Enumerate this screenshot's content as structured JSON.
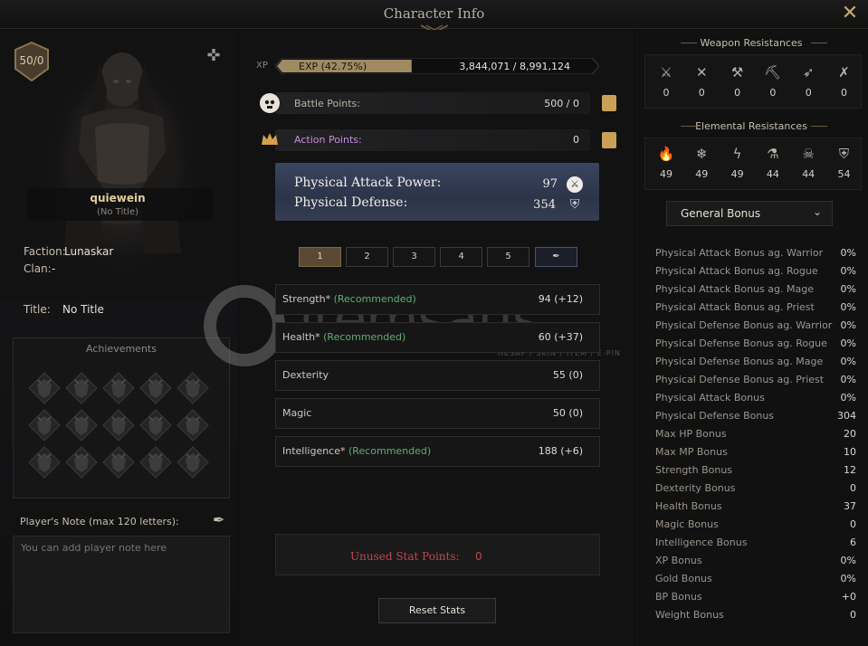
{
  "window": {
    "title": "Character Info",
    "close_icon": "close-x-icon"
  },
  "character": {
    "level": "50/0",
    "name": "quiewein",
    "subtitle": "(No Title)",
    "faction_label": "Faction:",
    "faction": "Lunaskar",
    "clan_label": "Clan:",
    "clan": "-",
    "title_label": "Title:",
    "title": "No Title"
  },
  "achievements": {
    "title": "Achievements",
    "count": 15
  },
  "note": {
    "label": "Player's Note (max 120 letters):",
    "placeholder": "You can add player note here"
  },
  "xp": {
    "label": "XP",
    "bar_text": "EXP (42.75%)",
    "values": "3,844,071 / 8,991,124",
    "fill_fraction": 0.4275
  },
  "battle_points": {
    "label": "Battle Points:",
    "value": "500 / 0"
  },
  "action_points": {
    "label": "Action Points:",
    "value": "0"
  },
  "attack": {
    "phys_attack_label": "Physical Attack Power:",
    "phys_attack_value": "97",
    "phys_defense_label": "Physical Defense:",
    "phys_defense_value": "354"
  },
  "tabs": [
    "1",
    "2",
    "3",
    "4",
    "5"
  ],
  "stats": [
    {
      "name": "Strength*",
      "rec": "(Recommended)",
      "value": "94 (+12)"
    },
    {
      "name": "Health*",
      "rec": "(Recommended)",
      "value": "60 (+37)"
    },
    {
      "name": "Dexterity",
      "rec": "",
      "value": "55 (0)"
    },
    {
      "name": "Magic",
      "rec": "",
      "value": "50 (0)"
    },
    {
      "name": "Intelligence*",
      "rec": "(Recommended)",
      "value": "188 (+6)"
    }
  ],
  "unused": {
    "label": "Unused Stat Points:",
    "value": "0"
  },
  "reset_label": "Reset Stats",
  "weapon_res": {
    "title": "Weapon Resistances",
    "icons": [
      "crossed-swords-icon",
      "axes-icon",
      "hammer-icon",
      "pickaxe-icon",
      "arrows-icon",
      "crossed-spears-icon"
    ],
    "values": [
      "0",
      "0",
      "0",
      "0",
      "0",
      "0"
    ]
  },
  "elemental_res": {
    "title": "Elemental Resistances",
    "icons": [
      "fire-icon",
      "ice-icon",
      "lightning-icon",
      "poison-icon",
      "curse-icon",
      "shield-icon"
    ],
    "values": [
      "49",
      "49",
      "49",
      "44",
      "44",
      "54"
    ]
  },
  "bonus_select": "General Bonus",
  "bonuses": [
    {
      "name": "Physical Attack Bonus ag. Warrior",
      "value": "0%"
    },
    {
      "name": "Physical Attack Bonus ag. Rogue",
      "value": "0%"
    },
    {
      "name": "Physical Attack Bonus ag. Mage",
      "value": "0%"
    },
    {
      "name": "Physical Attack Bonus ag. Priest",
      "value": "0%"
    },
    {
      "name": "Physical Defense Bonus ag. Warrior",
      "value": "0%"
    },
    {
      "name": "Physical Defense Bonus ag. Rogue",
      "value": "0%"
    },
    {
      "name": "Physical Defense Bonus ag. Mage",
      "value": "0%"
    },
    {
      "name": "Physical Defense Bonus ag. Priest",
      "value": "0%"
    },
    {
      "name": "Physical Attack Bonus",
      "value": "0%"
    },
    {
      "name": "Physical Defense Bonus",
      "value": "304"
    },
    {
      "name": "Max HP Bonus",
      "value": "20"
    },
    {
      "name": "Max MP Bonus",
      "value": "10"
    },
    {
      "name": "Strength Bonus",
      "value": "12"
    },
    {
      "name": "Dexterity Bonus",
      "value": "0"
    },
    {
      "name": "Health Bonus",
      "value": "37"
    },
    {
      "name": "Magic Bonus",
      "value": "0"
    },
    {
      "name": "Intelligence Bonus",
      "value": "6"
    },
    {
      "name": "XP Bonus",
      "value": "0%"
    },
    {
      "name": "Gold Bonus",
      "value": "0%"
    },
    {
      "name": "BP Bonus",
      "value": "+0"
    },
    {
      "name": "Weight Bonus",
      "value": "0"
    }
  ],
  "watermark": {
    "text": "itemsatış",
    "sub": "HESAP / SKIN / ITEM / E-PIN"
  },
  "colors": {
    "accent_gold": "#c9a258",
    "recommended_green": "#5fae72",
    "warning_red": "#c0484a",
    "attack_card_blue": "#2b3448"
  }
}
